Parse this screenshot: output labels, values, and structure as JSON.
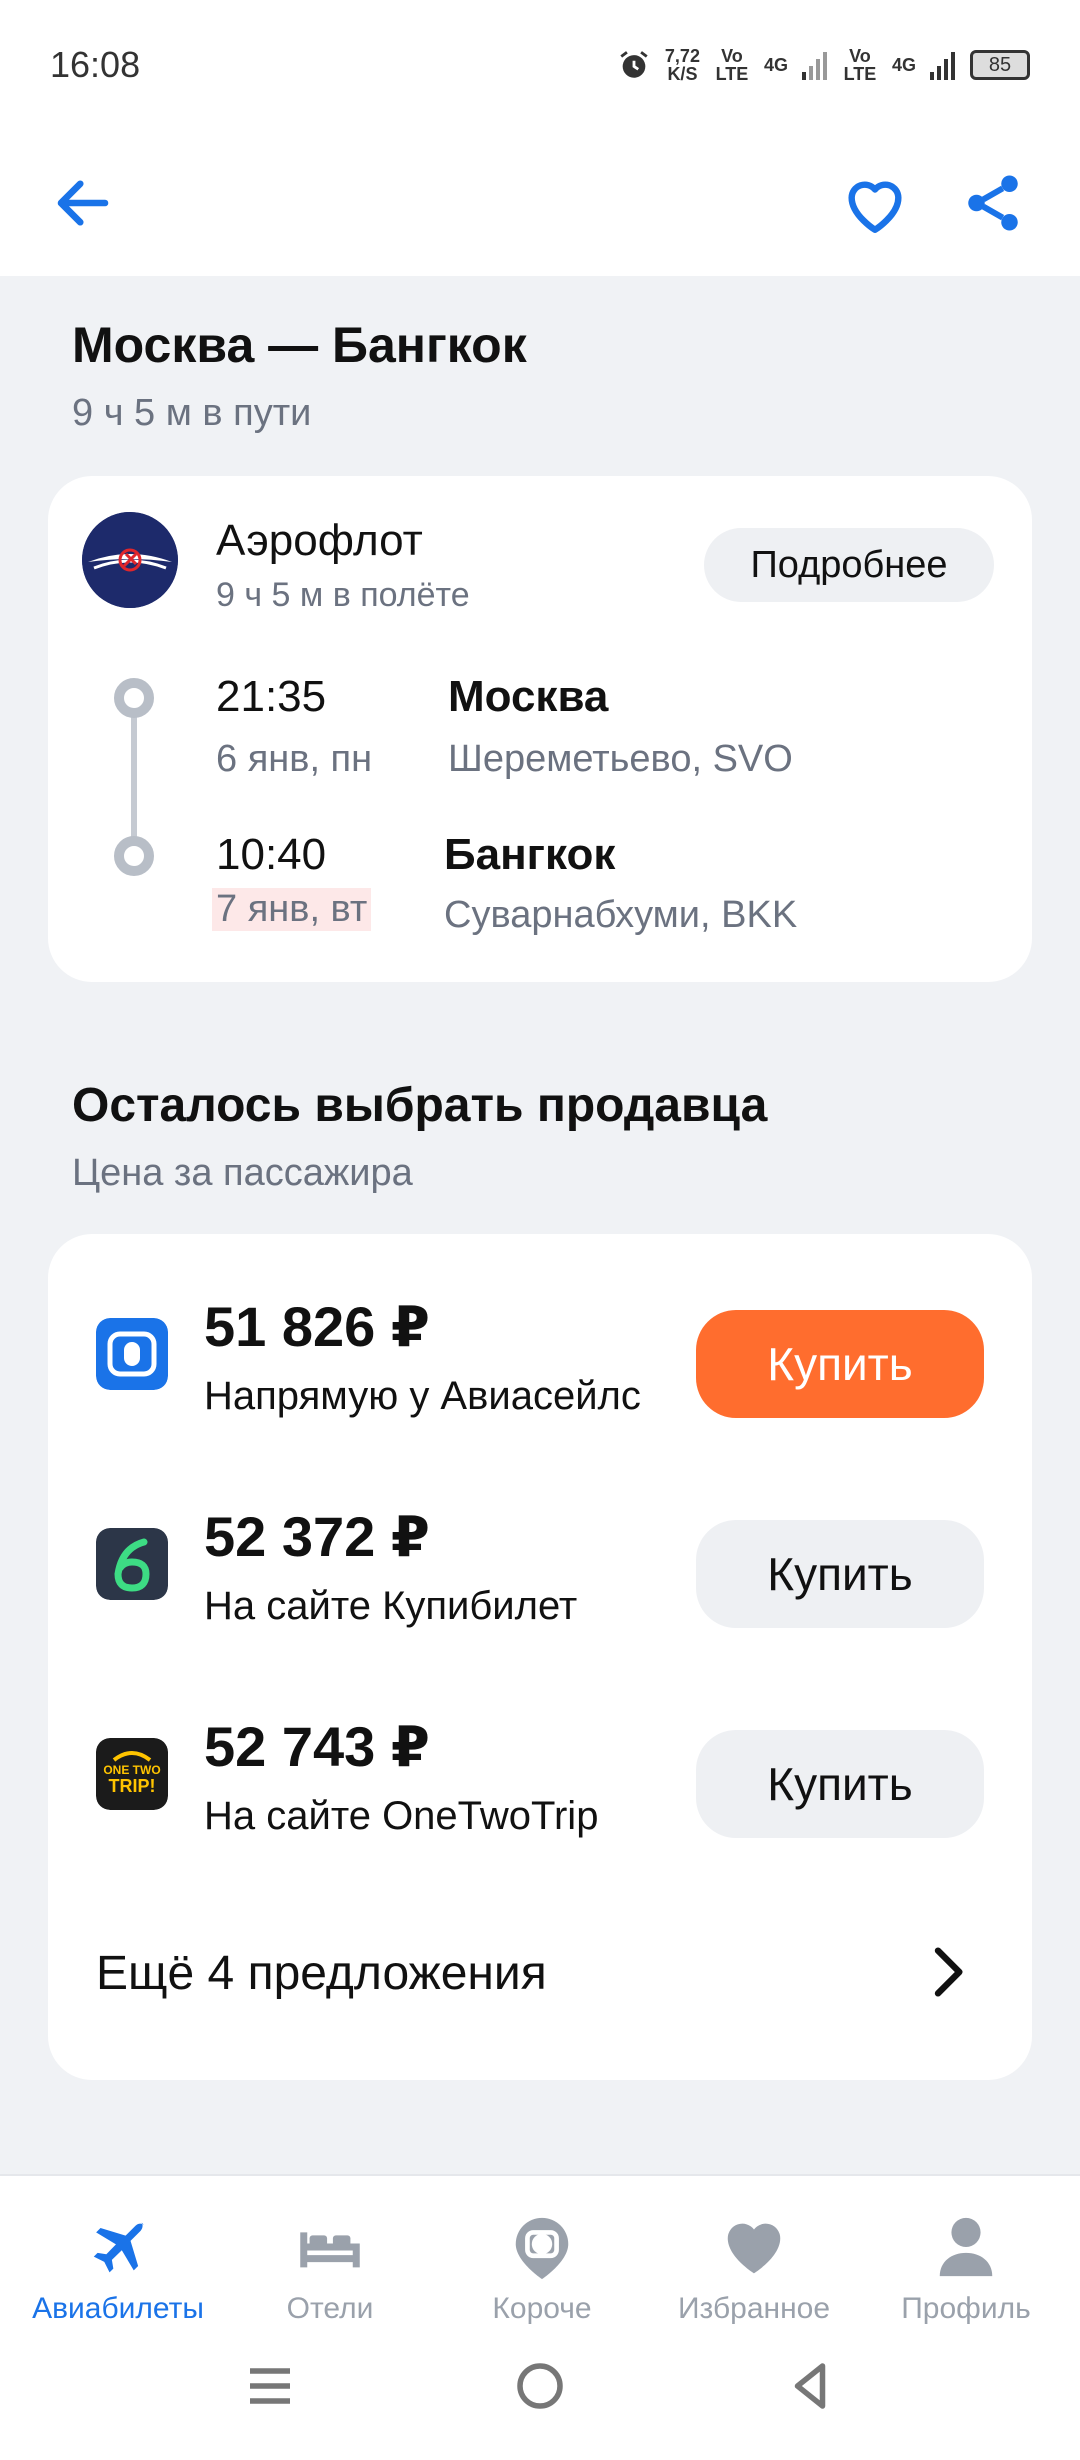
{
  "status_bar": {
    "time": "16:08",
    "net_speed": "7,72",
    "net_unit": "K/S",
    "sim1": "Vo LTE",
    "sim1_type": "4G",
    "sim2": "Vo LTE",
    "sim2_type": "4G",
    "battery": "85"
  },
  "app_bar": {
    "back_icon": "arrow-left-icon",
    "favorite_icon": "heart-icon",
    "share_icon": "share-icon",
    "accent": "#1a73e8"
  },
  "route": {
    "title": "Москва — Бангкок",
    "duration": "9 ч 5 м в пути"
  },
  "flight": {
    "airline": "Аэрофлот",
    "flight_duration": "9 ч 5 м в полёте",
    "details_label": "Подробнее",
    "departure": {
      "time": "21:35",
      "date": "6 янв, пн",
      "city": "Москва",
      "airport": "Шереметьево, SVO"
    },
    "arrival": {
      "time": "10:40",
      "date": "7 янв, вт",
      "city": "Бангкок",
      "airport": "Суварнабхуми, BKK"
    }
  },
  "sellers": {
    "title": "Осталось выбрать продавца",
    "subtitle": "Цена за пассажира",
    "offers": [
      {
        "price": "51 826 ₽",
        "seller": "Напрямую у Авиасейлс",
        "buy_label": "Купить",
        "primary": true
      },
      {
        "price": "52 372 ₽",
        "seller": "На сайте Купибилет",
        "buy_label": "Купить",
        "primary": false
      },
      {
        "price": "52 743 ₽",
        "seller": "На сайте OneTwoTrip",
        "buy_label": "Купить",
        "primary": false
      }
    ],
    "more_label": "Ещё 4 предложения",
    "primary_color": "#ff6d2e"
  },
  "bottom_nav": {
    "items": [
      {
        "label": "Авиабилеты",
        "icon": "plane-icon",
        "active": true
      },
      {
        "label": "Отели",
        "icon": "bed-icon",
        "active": false
      },
      {
        "label": "Короче",
        "icon": "camera-pin-icon",
        "active": false
      },
      {
        "label": "Избранное",
        "icon": "heart-icon",
        "active": false
      },
      {
        "label": "Профиль",
        "icon": "person-icon",
        "active": false
      }
    ]
  },
  "onetwotrip_logo_text": "ONE TWO TRIP!"
}
